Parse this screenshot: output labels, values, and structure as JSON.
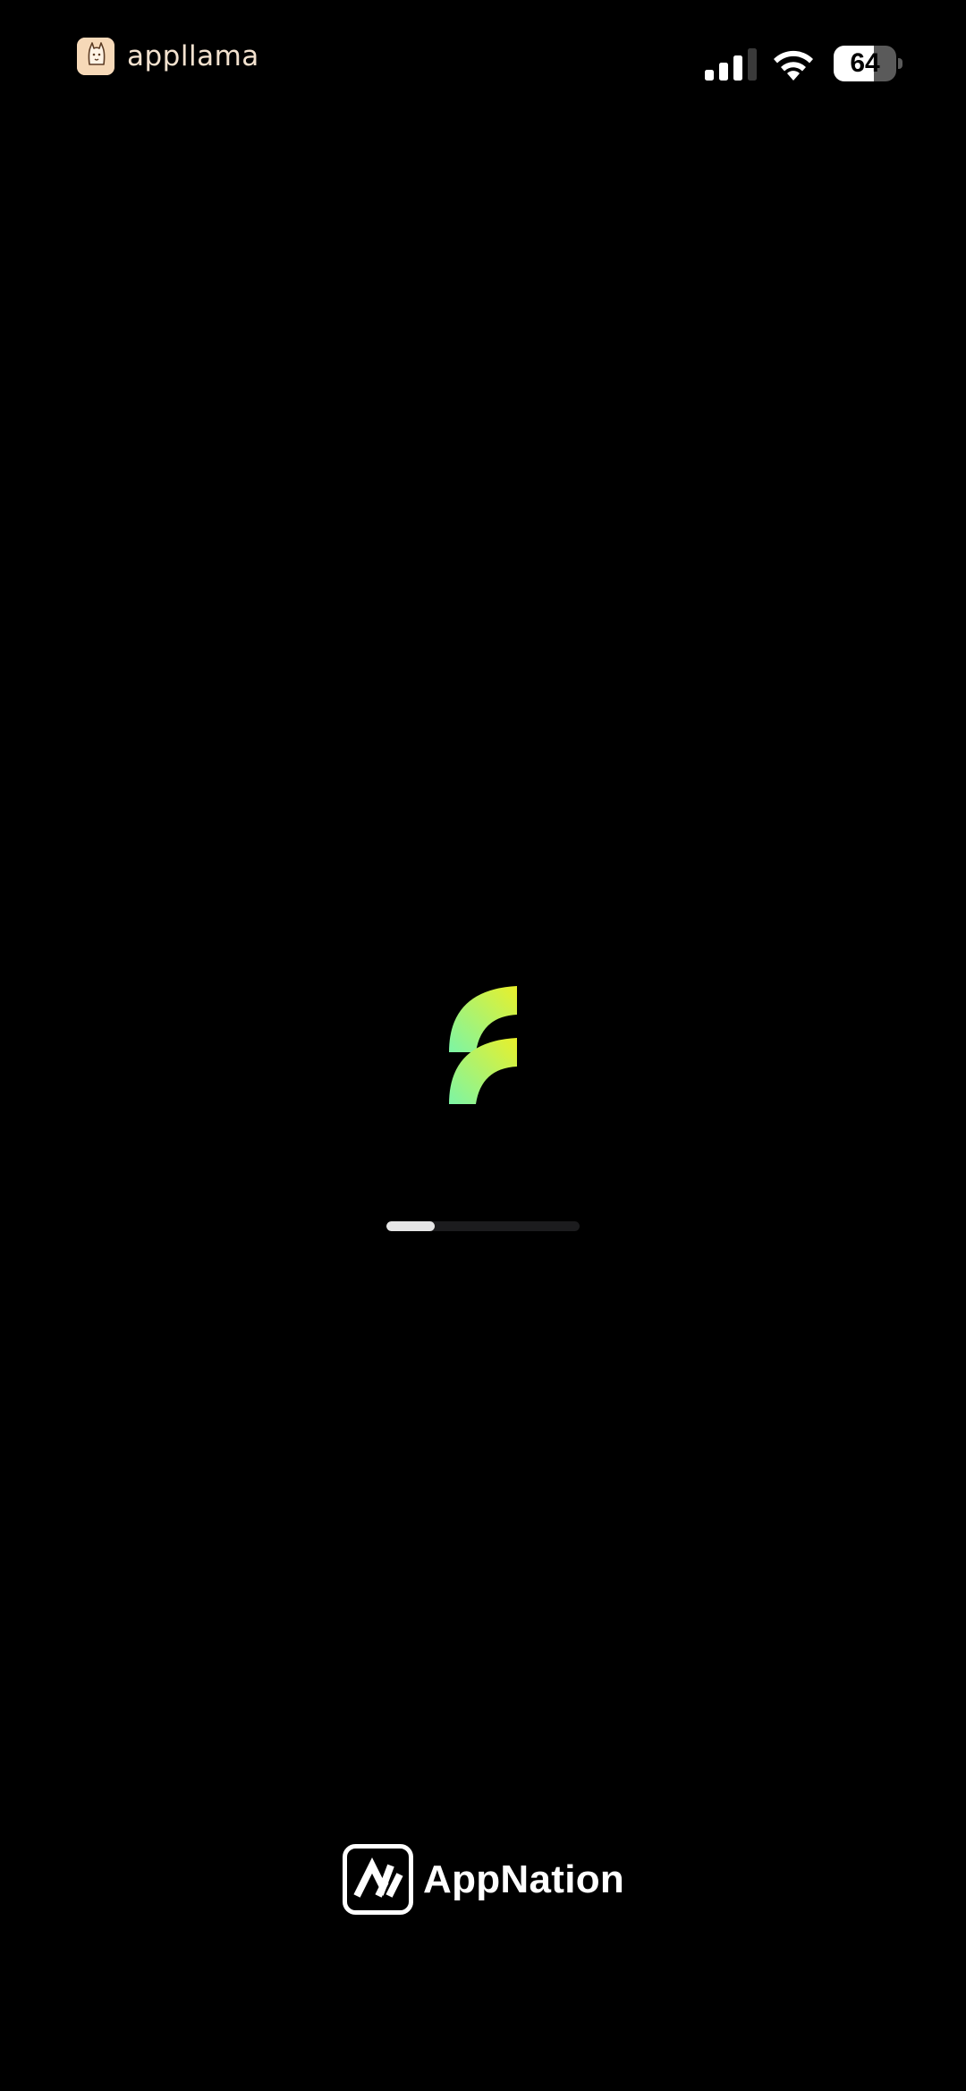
{
  "status_bar": {
    "watermark_text": "appllama",
    "watermark_icon": "llama-logo-icon",
    "signal_icon": "cellular-signal-icon",
    "signal_bars_active": 3,
    "signal_bars_total": 4,
    "wifi_icon": "wifi-icon",
    "battery_level": "64",
    "battery_fraction": 0.64
  },
  "splash": {
    "logo_icon": "app-logo-icon",
    "logo_gradient": [
      "#7cf5a6",
      "#e9f02a"
    ],
    "progress_fraction": 0.25
  },
  "brand": {
    "icon": "appnation-logo-icon",
    "name": "AppNation"
  },
  "colors": {
    "background": "#000000",
    "progress_track": "#1c1c1e",
    "progress_fill": "#e6e6e6",
    "battery_fill": "#ffffff",
    "battery_empty": "#5a5a5a"
  }
}
